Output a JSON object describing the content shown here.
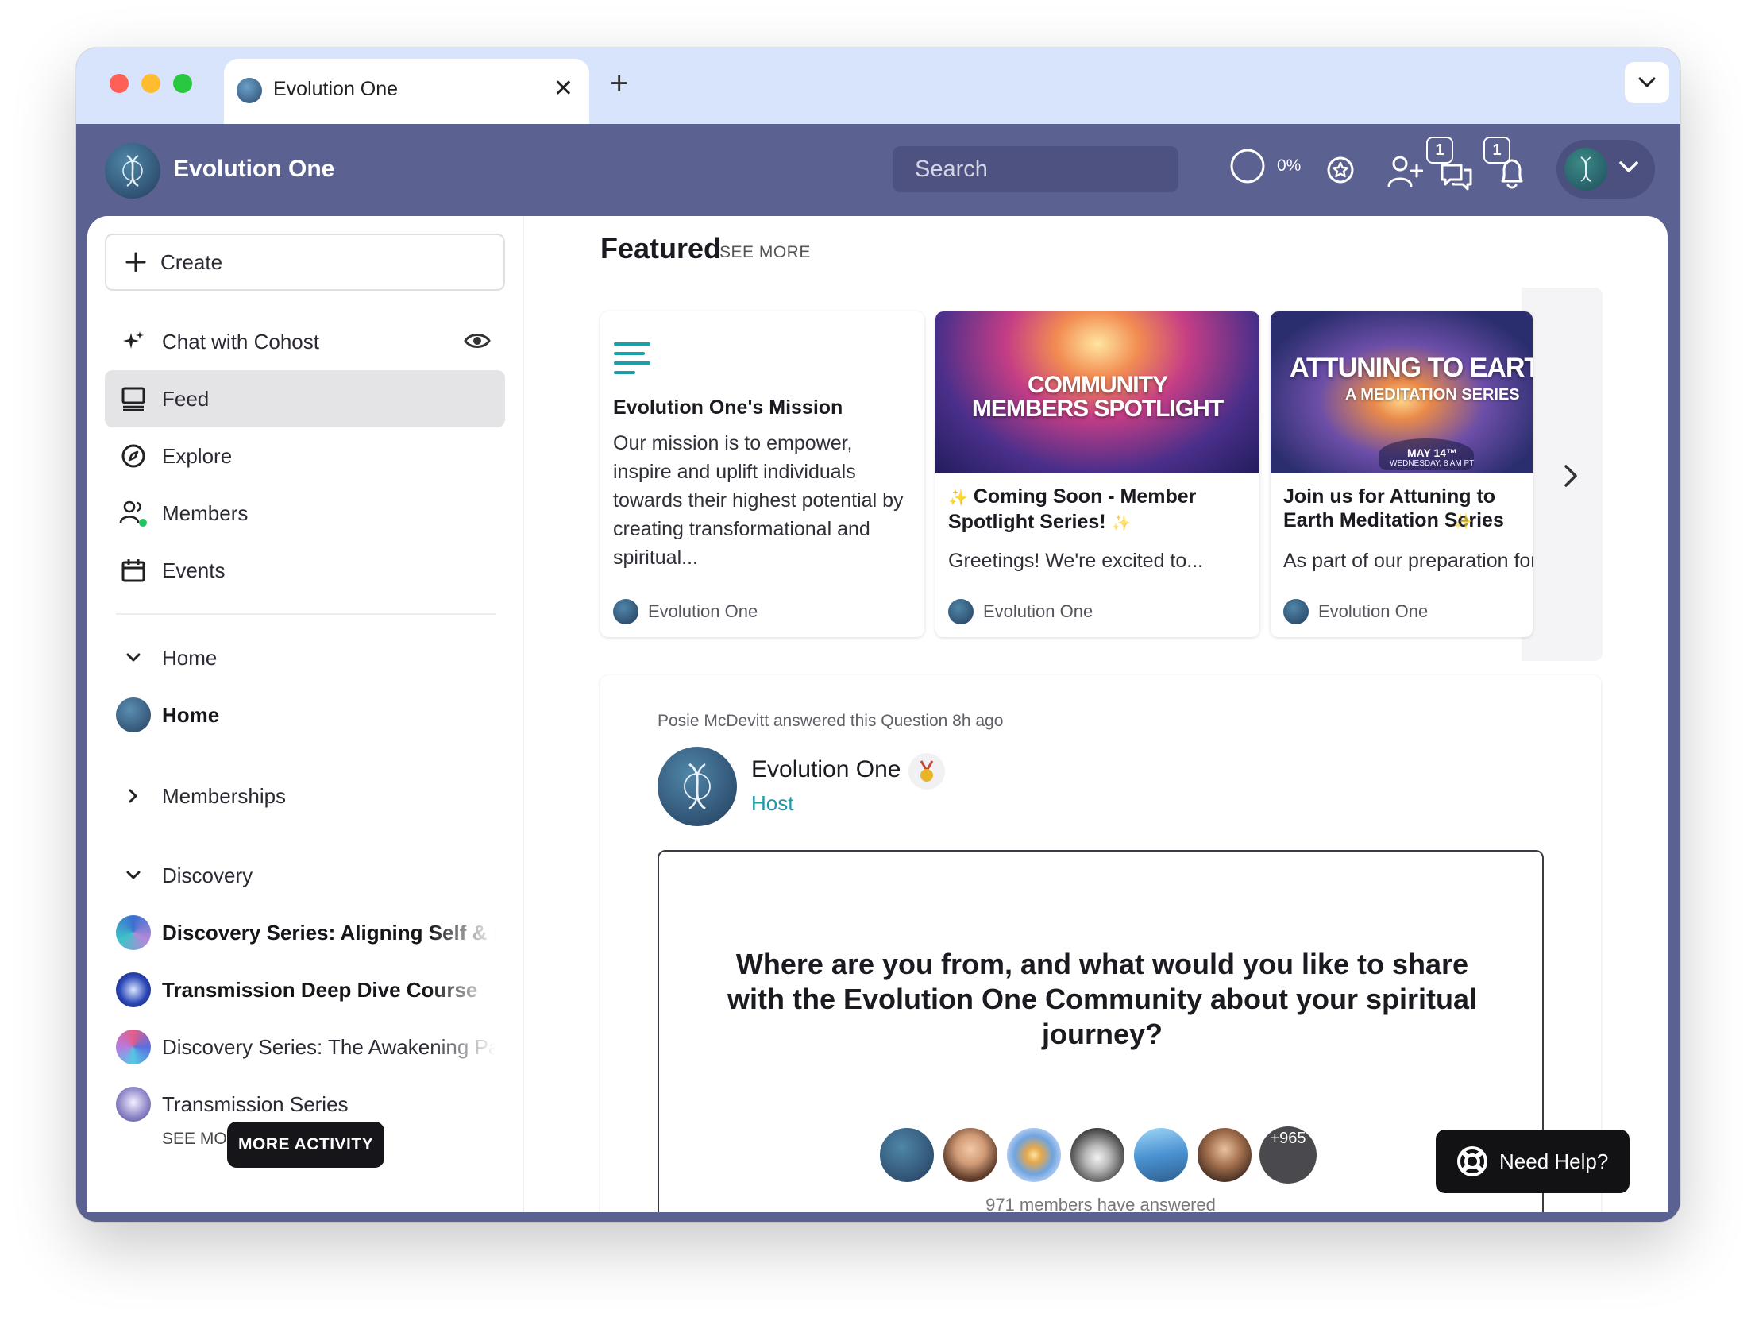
{
  "browser": {
    "tab_title": "Evolution One",
    "close_glyph": "✕",
    "new_tab_glyph": "+"
  },
  "header": {
    "brand": "Evolution One",
    "search_placeholder": "Search",
    "progress_label": "0%",
    "progress_value": 0,
    "chat_badge": "1",
    "notifications_badge": "1",
    "icons": [
      "search-icon",
      "progress-ring-icon",
      "star-badge-icon",
      "add-user-icon",
      "chat-icon",
      "bell-icon",
      "chevron-down-icon"
    ]
  },
  "sidebar": {
    "create_label": "Create",
    "chat_label": "Chat with Cohost",
    "nav": [
      {
        "label": "Feed",
        "icon": "feed-icon",
        "active": true
      },
      {
        "label": "Explore",
        "icon": "compass-icon"
      },
      {
        "label": "Members",
        "icon": "members-icon"
      },
      {
        "label": "Events",
        "icon": "calendar-icon"
      }
    ],
    "home_section": "Home",
    "home_space": "Home",
    "memberships_section": "Memberships",
    "discovery_section": "Discovery",
    "spaces": [
      {
        "label": "Discovery Series: Aligning Self & Planet",
        "bold": true
      },
      {
        "label": "Transmission Deep Dive Course",
        "bold": true
      },
      {
        "label": "Discovery Series: The Awakening Path",
        "bold": false
      },
      {
        "label": "Transmission Series",
        "bold": false
      }
    ],
    "see_more": "SEE MORE",
    "more_activity": "MORE ACTIVITY"
  },
  "featured": {
    "title": "Featured",
    "see_more": "SEE MORE",
    "cards": [
      {
        "title": "Evolution One's Mission",
        "body": "Our mission is to empower, inspire and uplift individuals towards their highest potential by creating transformational and spiritual...",
        "author": "Evolution One"
      },
      {
        "image_line1": "COMMUNITY",
        "image_line2": "MEMBERS SPOTLIGHT",
        "title_prefix": "✨",
        "title": "Coming Soon - Member Spotlight Series!",
        "title_suffix": "✨",
        "body": "Greetings! We're excited to...",
        "author": "Evolution One"
      },
      {
        "image_line1": "ATTUNING TO EARTH",
        "image_line2": "A MEDITATION SERIES",
        "image_date": "MAY 14™",
        "image_time": "WEDNESDAY, 8 AM PT",
        "title": "Join us for Attuning to Earth Meditation Series",
        "title_suffix": "✨",
        "body": "As part of our preparation for the Transmission",
        "author": "Evolution One"
      }
    ]
  },
  "post": {
    "meta": "Posie McDevitt answered this Question 8h ago",
    "author": "Evolution One",
    "role": "Host",
    "question": "Where are you from, and what would you like to share with the Evolution One Community about your spiritual journey?",
    "more_count": "+965",
    "answered_text": "971 members have answered"
  },
  "help": {
    "label": "Need Help?"
  },
  "colors": {
    "header_bg": "#5b6190",
    "chrome_bg": "#d8e4fb",
    "accent_teal": "#1c9aa6",
    "active_nav": "#e4e4e7"
  }
}
